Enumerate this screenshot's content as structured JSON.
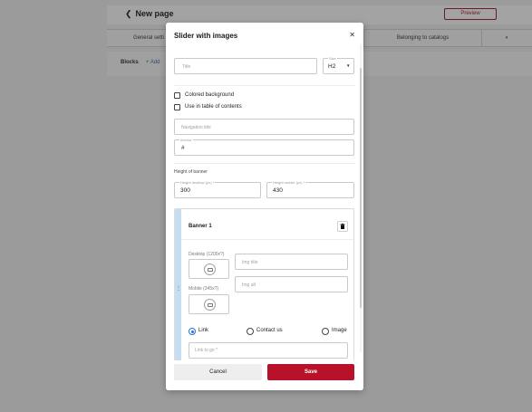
{
  "colors": {
    "accent": "#b8122a",
    "overlay": "#9b9b9b",
    "radio_active": "#2a6fd6",
    "banner_strip": "#c7ddf2"
  },
  "background": {
    "back_label": "New page",
    "preview_label": "Preview",
    "tabs": [
      "General setti",
      "Belonging to catalogs",
      ""
    ],
    "blocks_label": "Blocks",
    "add_label": "+ Add"
  },
  "modal": {
    "title": "Slider with images",
    "close_icon": "close-icon",
    "title_field": {
      "placeholder": "Title"
    },
    "size_field": {
      "label": "Size",
      "value": "H2"
    },
    "checkboxes": [
      {
        "label": "Colored background",
        "checked": false
      },
      {
        "label": "Use in table of contents",
        "checked": false
      }
    ],
    "navigation_title": {
      "placeholder": "Navigation title"
    },
    "anchor": {
      "label": "Anchor",
      "value": "#"
    },
    "height_section": {
      "title": "Height of banner",
      "desktop": {
        "label": "Height desktop (px) *",
        "value": "300"
      },
      "mobile": {
        "label": "Height mobile (px) *",
        "value": "430"
      }
    },
    "banner": {
      "title": "Banner 1",
      "desktop_label": "Desktop (1200x?)",
      "mobile_label": "Mobile (345x?)",
      "img_title_placeholder": "Img title",
      "img_alt_placeholder": "Img alt",
      "radios": [
        {
          "label": "Link",
          "selected": true
        },
        {
          "label": "Contact us",
          "selected": false
        },
        {
          "label": "Image",
          "selected": false
        }
      ],
      "link_placeholder": "Link to go *"
    },
    "footer": {
      "cancel_label": "Cancel",
      "save_label": "Save"
    }
  }
}
